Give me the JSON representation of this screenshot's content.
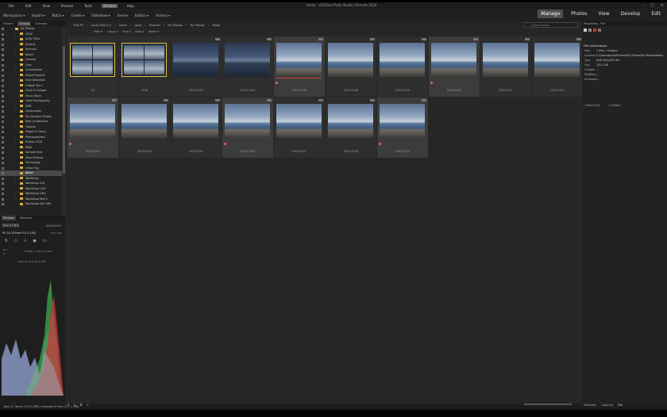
{
  "window": {
    "title": "Folder - ACDSee Photo Studio Ultimate 2020"
  },
  "menu": [
    "File",
    "Edit",
    "View",
    "Process",
    "Tools",
    "Window",
    "Help"
  ],
  "menu_active_index": 5,
  "toolbar": {
    "workspaces": "Workspaces ▾",
    "import": "Import ▾",
    "batch": "Batch ▾",
    "create": "Create ▾",
    "slideshow": "Slideshow ▾",
    "send": "Send ▾",
    "editors": "Editors ▾",
    "actions": "Actions ▾"
  },
  "modes": {
    "manage": "Manage",
    "photos": "Photos",
    "view": "View",
    "develop": "Develop",
    "edit": "Edit"
  },
  "left_tabs": [
    "Folders",
    "Catalog",
    "Calendar"
  ],
  "tree": [
    {
      "label": "My Photos",
      "depth": 0
    },
    {
      "label": "2016",
      "depth": 1
    },
    {
      "label": "ACDC Files",
      "depth": 1
    },
    {
      "label": "Actions",
      "depth": 1
    },
    {
      "label": "Animals",
      "depth": 1
    },
    {
      "label": "Beach",
      "depth": 1
    },
    {
      "label": "Canada",
      "depth": 1
    },
    {
      "label": "Cats",
      "depth": 1
    },
    {
      "label": "Composition",
      "depth": 1
    },
    {
      "label": "Edited Product",
      "depth": 1
    },
    {
      "label": "Face Detection",
      "depth": 1
    },
    {
      "label": "Fireball Sky F",
      "depth": 1
    },
    {
      "label": "Floral & Foliage",
      "depth": 1
    },
    {
      "label": "Focus Stack",
      "depth": 1
    },
    {
      "label": "Food Photography",
      "depth": 1
    },
    {
      "label": "HDR",
      "depth": 1
    },
    {
      "label": "Landscapes",
      "depth": 1
    },
    {
      "label": "My Vacation Photos",
      "depth": 1
    },
    {
      "label": "New Landscapes",
      "depth": 1
    },
    {
      "label": "Objects",
      "depth": 1
    },
    {
      "label": "People & Faces",
      "depth": 1
    },
    {
      "label": "Photographers",
      "depth": 1
    },
    {
      "label": "Photos 2018",
      "depth": 1
    },
    {
      "label": "RAW",
      "depth": 1
    },
    {
      "label": "Sample Files",
      "depth": 1
    },
    {
      "label": "Slow Pictures",
      "depth": 1
    },
    {
      "label": "Technology",
      "depth": 1
    },
    {
      "label": "Urban fog",
      "depth": 1
    },
    {
      "label": "Water",
      "depth": 1,
      "selected": true
    },
    {
      "label": "Weddings",
      "depth": 1
    },
    {
      "label": "Workshop 2nd",
      "depth": 1
    },
    {
      "label": "Workshop 11th",
      "depth": 1
    },
    {
      "label": "Workshop 19th",
      "depth": 1
    },
    {
      "label": "Workshop Test 3",
      "depth": 1
    },
    {
      "label": "Workshop Fall 19th",
      "depth": 1
    }
  ],
  "preview": {
    "tabs": [
      "Preview",
      "Selection"
    ],
    "file": "DSC07405",
    "dimensions": "6000x4000",
    "lens": "FE 24-105mm F4 G OSS",
    "fstop": "f/7.1 1/8",
    "exposure": "0.0",
    "iso": "0",
    "settings": "3,7000 s  1.00 m  24 mm",
    "date": "2019-08-16 4:46:41 PM"
  },
  "path": [
    "This PC",
    "Local Disk (C:)",
    "Users",
    "tpsts",
    "Pictures",
    "My Photos",
    "My Photos",
    "Water"
  ],
  "search": {
    "placeholder": "Quick Search"
  },
  "filters": [
    "Filter ▾",
    "Group ▾",
    "Sort ▾",
    "View ▾",
    "Select ▾"
  ],
  "thumbnails": [
    {
      "label": "IFS",
      "type": "folder"
    },
    {
      "label": "uFlat",
      "type": "folder"
    },
    {
      "label": "DSC07425",
      "type": "dark"
    },
    {
      "label": "DSC07426",
      "type": "dark"
    },
    {
      "label": "DSC07436",
      "type": "coast",
      "selected": true,
      "redline": true
    },
    {
      "label": "DSC07438",
      "type": "coast"
    },
    {
      "label": "DSC07439",
      "type": "coast"
    },
    {
      "label": "DSC07440",
      "type": "coast",
      "selected": true
    },
    {
      "label": "DSC07441",
      "type": "coast"
    },
    {
      "label": "DSC07442",
      "type": "coast"
    },
    {
      "label": "DSC07443",
      "type": "coast",
      "selected": true
    },
    {
      "label": "DSC07444",
      "type": "coast"
    },
    {
      "label": "DSC07445",
      "type": "coast"
    },
    {
      "label": "DSC07446",
      "type": "coast",
      "selected": true
    },
    {
      "label": "DSC07447",
      "type": "coast"
    },
    {
      "label": "DSC07448",
      "type": "coast"
    },
    {
      "label": "DSC07449",
      "type": "coast",
      "selected": true
    }
  ],
  "properties": {
    "tabs": [
      "Properties - File"
    ],
    "section": "File Information",
    "rows": [
      {
        "k": "Files",
        "v": "1 files, 2 Folders"
      },
      {
        "k": "Location",
        "v": "C:\\Users\\tpsts\\Pictures\\My Photos\\My Photos\\Water"
      },
      {
        "k": "Type",
        "v": "ACD Ultra JPG File"
      },
      {
        "k": "Size",
        "v": "120.1 KB"
      },
      {
        "k": "Created",
        "v": "—"
      },
      {
        "k": "Modified",
        "v": "—"
      },
      {
        "k": "Accessed",
        "v": "—"
      }
    ],
    "attributes": [
      "Read Only",
      "Hidden"
    ],
    "bottom_tabs": [
      "Metadata",
      "Organize",
      "File"
    ]
  },
  "status": {
    "text": "Total 17 items (730.1 MB)   |   Selected 0 files (117.1 MB)"
  },
  "colors": {
    "accent": "#e6c23a",
    "red": "#c84a3a"
  }
}
